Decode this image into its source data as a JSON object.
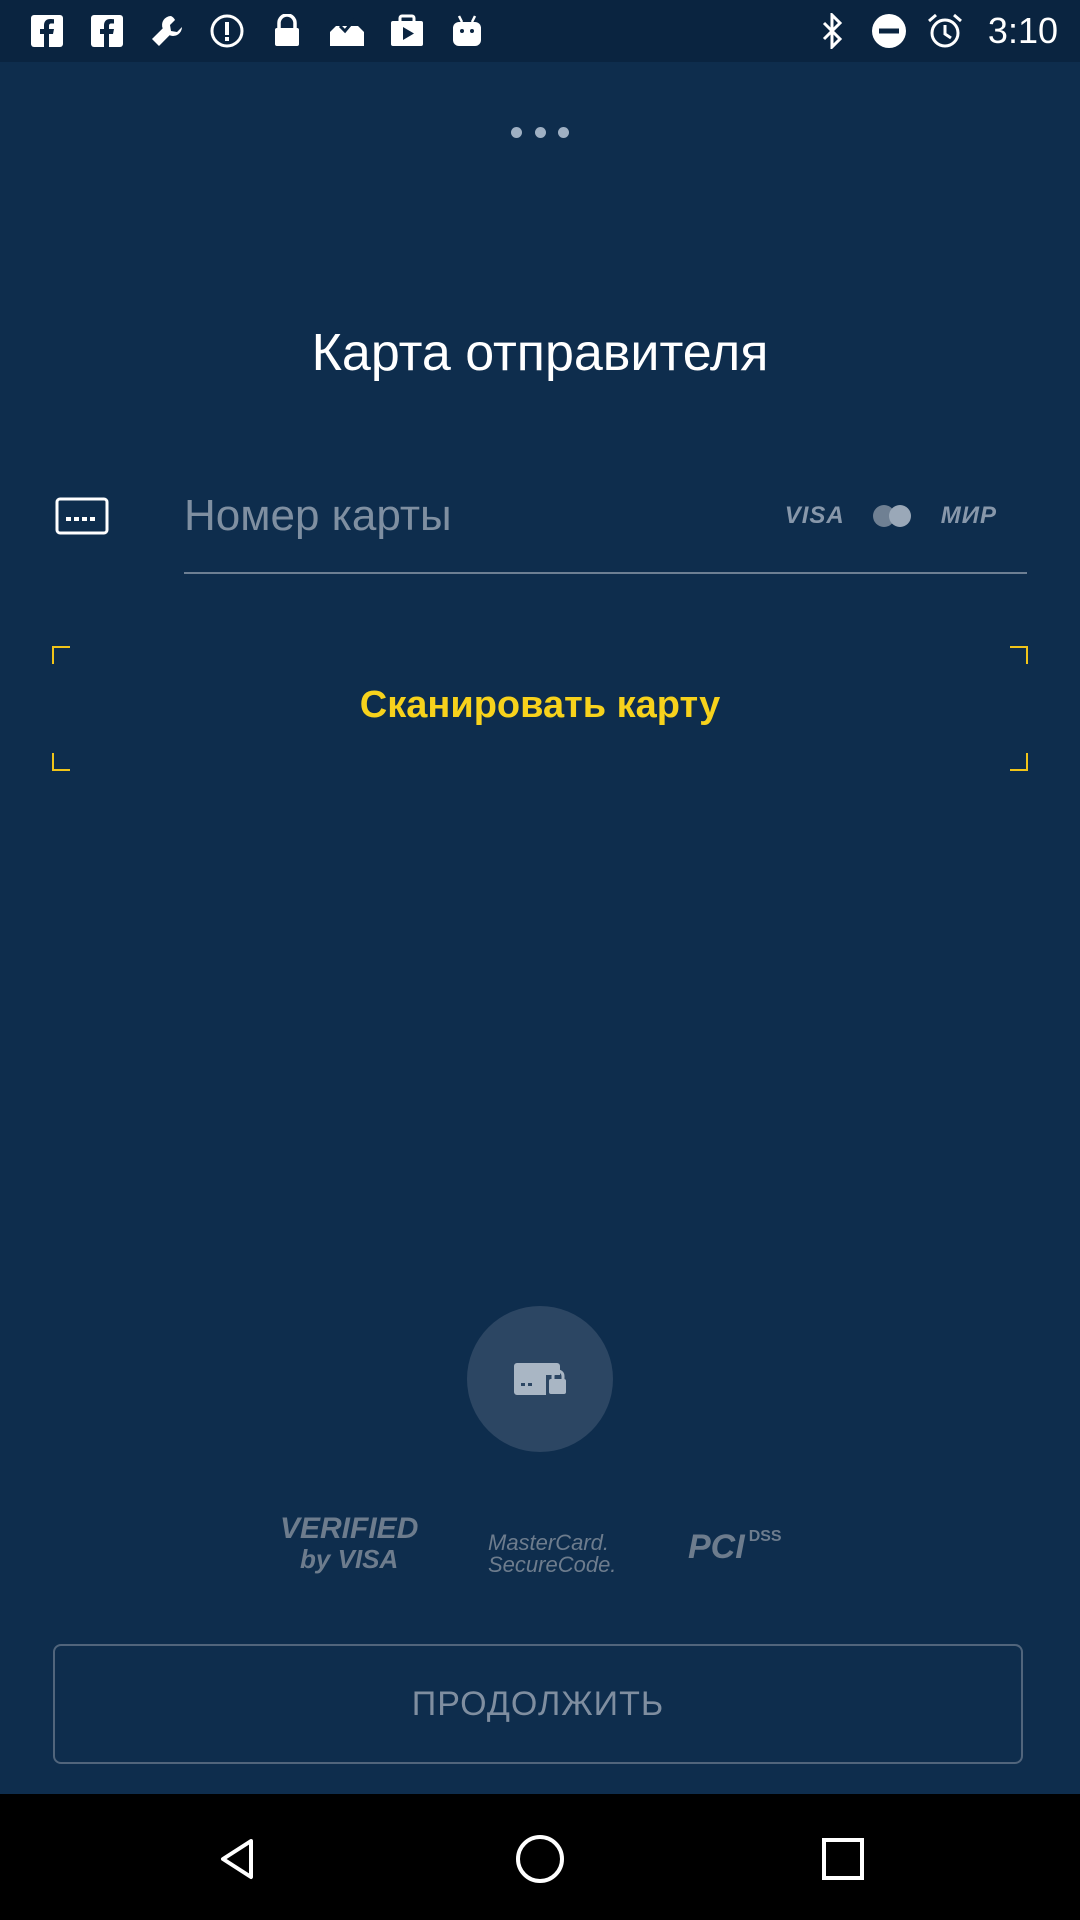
{
  "status_bar": {
    "time": "3:10",
    "left_icons": [
      "facebook-icon",
      "facebook-icon",
      "wrench-icon",
      "info-icon",
      "lock-icon",
      "inbox-check-icon",
      "play-store-icon",
      "android-icon"
    ],
    "right_icons": [
      "bluetooth-icon",
      "do-not-disturb-icon",
      "alarm-icon"
    ]
  },
  "header": {
    "menu_icon": "more-dots-icon"
  },
  "title": "Карта отправителя",
  "card_field": {
    "placeholder": "Номер карты",
    "value": "",
    "brands": {
      "visa": "VISA",
      "mir": "МИР"
    }
  },
  "scan": {
    "label": "Сканировать карту"
  },
  "security": {
    "verified_line1": "VERIFIED",
    "verified_line2": "by VISA",
    "msc_line1": "MasterCard.",
    "msc_line2": "SecureCode.",
    "pci": "PCI",
    "dss": "DSS"
  },
  "continue_label": "ПРОДОЛЖИТЬ",
  "colors": {
    "background": "#0e2d4d",
    "accent_yellow": "#f7d21c",
    "muted": "#7f8ea0"
  }
}
